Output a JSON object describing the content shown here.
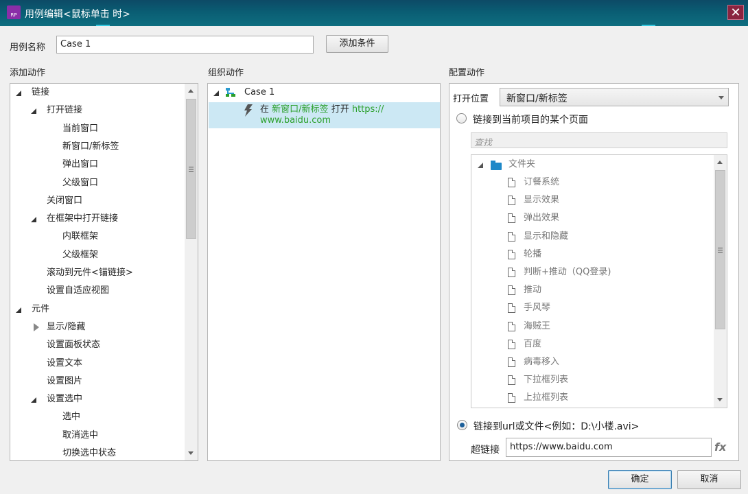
{
  "window": {
    "title": "用例编辑<鼠标单击 时>",
    "icon_text": "RP",
    "close_glyph": "✕"
  },
  "case_name": {
    "label": "用例名称",
    "value": "Case 1",
    "add_condition_label": "添加条件"
  },
  "add_actions": {
    "heading": "添加动作",
    "items": [
      {
        "label": "链接",
        "level": 0,
        "toggle": "open"
      },
      {
        "label": "打开链接",
        "level": 1,
        "toggle": "open"
      },
      {
        "label": "当前窗口",
        "level": 2,
        "toggle": "none"
      },
      {
        "label": "新窗口/新标签",
        "level": 2,
        "toggle": "none"
      },
      {
        "label": "弹出窗口",
        "level": 2,
        "toggle": "none"
      },
      {
        "label": "父级窗口",
        "level": 2,
        "toggle": "none"
      },
      {
        "label": "关闭窗口",
        "level": 1,
        "toggle": "none"
      },
      {
        "label": "在框架中打开链接",
        "level": 1,
        "toggle": "open"
      },
      {
        "label": "内联框架",
        "level": 2,
        "toggle": "none"
      },
      {
        "label": "父级框架",
        "level": 2,
        "toggle": "none"
      },
      {
        "label": "滚动到元件<锚链接>",
        "level": 1,
        "toggle": "none"
      },
      {
        "label": "设置自适应视图",
        "level": 1,
        "toggle": "none"
      },
      {
        "label": "元件",
        "level": 0,
        "toggle": "open"
      },
      {
        "label": "显示/隐藏",
        "level": 1,
        "toggle": "closed"
      },
      {
        "label": "设置面板状态",
        "level": 1,
        "toggle": "none"
      },
      {
        "label": "设置文本",
        "level": 1,
        "toggle": "none"
      },
      {
        "label": "设置图片",
        "level": 1,
        "toggle": "none"
      },
      {
        "label": "设置选中",
        "level": 1,
        "toggle": "open"
      },
      {
        "label": "选中",
        "level": 2,
        "toggle": "none"
      },
      {
        "label": "取消选中",
        "level": 2,
        "toggle": "none"
      },
      {
        "label": "切换选中状态",
        "level": 2,
        "toggle": "none"
      }
    ]
  },
  "organize_actions": {
    "heading": "组织动作",
    "case_label": "Case 1",
    "action": {
      "prefix": "在",
      "target": "新窗口/新标签",
      "verb": "打开",
      "url_line1": "https://",
      "url_line2": "www.baidu.com"
    }
  },
  "configure_actions": {
    "heading": "配置动作",
    "open_in_label": "打开位置",
    "open_in_value": "新窗口/新标签",
    "option_page_label": "链接到当前项目的某个页面",
    "search_placeholder": "查找",
    "folder_label": "文件夹",
    "pages": [
      "订餐系统",
      "显示效果",
      "弹出效果",
      "显示和隐藏",
      "轮播",
      "判断+推动（QQ登录)",
      "推动",
      "手风琴",
      "海贼王",
      "百度",
      "病毒移入",
      "下拉框列表",
      "上拉框列表"
    ],
    "option_url_label": "链接到url或文件<例如：D:\\小楼.avi>",
    "hyperlink_label": "超链接",
    "hyperlink_value": "https://www.baidu.com",
    "fx_label": "fx"
  },
  "footer": {
    "ok_label": "确定",
    "cancel_label": "取消"
  },
  "colors": {
    "selection": "#cce8f4",
    "link_green": "#2ca02c",
    "titlebar": "#0a5d73"
  }
}
